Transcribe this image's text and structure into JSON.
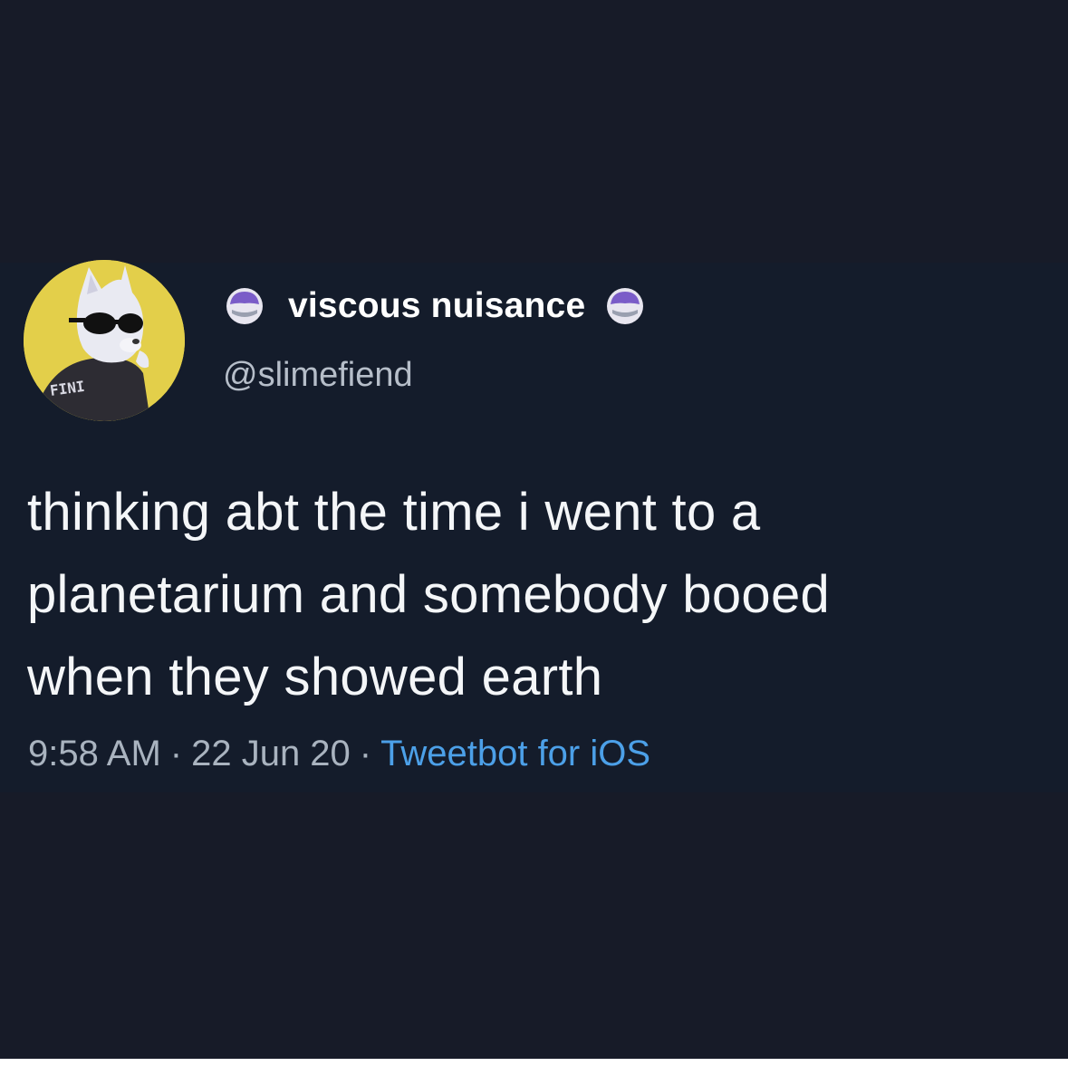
{
  "tweet": {
    "display_name": "viscous nuisance",
    "handle": "@slimefiend",
    "text_lines": [
      "thinking abt the time i went to a",
      "planetarium and somebody booed",
      "when they showed earth"
    ],
    "time": "9:58 AM",
    "separator": "·",
    "date": "22 Jun 20",
    "source": "Tweetbot for iOS",
    "avatar_icon": "cartoon-dog-sunglasses-avatar",
    "avatar_shirt_text": "FINI",
    "badge_icon": "purple-slime-emoji"
  },
  "colors": {
    "background": "#171b28",
    "card": "#141c2b",
    "text": "#f4f6f8",
    "muted": "#a9b3bf",
    "link": "#4ca0e8",
    "avatar_bg": "#e3cf4a",
    "badge_purple": "#7a5cc8"
  }
}
